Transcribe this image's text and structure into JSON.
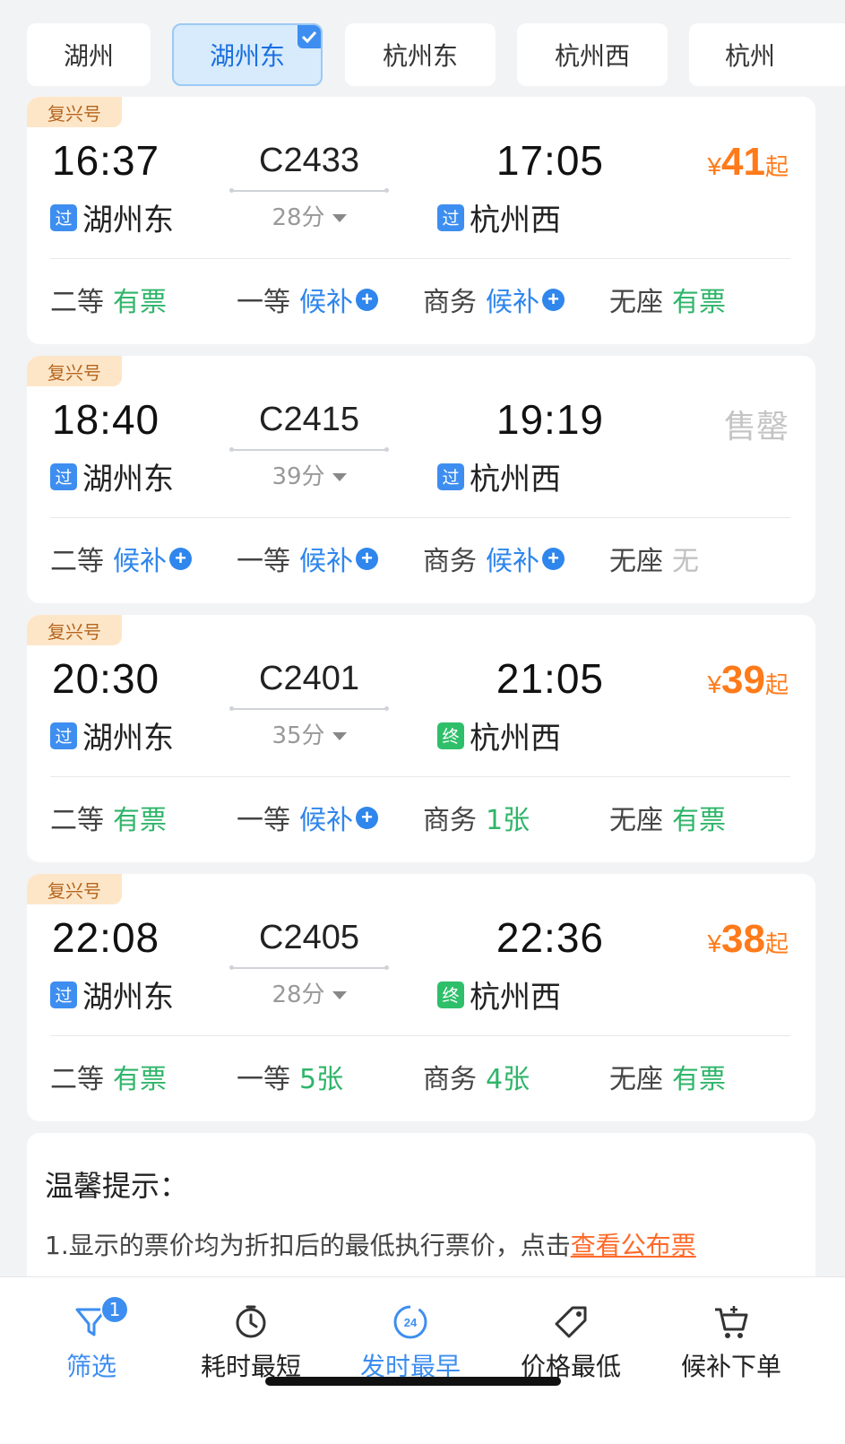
{
  "stations": [
    {
      "label": "湖州",
      "active": false
    },
    {
      "label": "湖州东",
      "active": true
    },
    {
      "label": "杭州东",
      "active": false
    },
    {
      "label": "杭州西",
      "active": false
    },
    {
      "label": "杭州",
      "active": false
    }
  ],
  "trains": [
    {
      "brand": "复兴号",
      "dep_time": "16:37",
      "arr_time": "17:05",
      "train_no": "C2433",
      "duration": "28分",
      "dep_tag": "过",
      "dep_station": "湖州东",
      "arr_tag": "过",
      "arr_station": "杭州西",
      "price_symbol": "¥",
      "price": "41",
      "price_suffix": "起",
      "status": "",
      "seats": [
        {
          "name": "二等",
          "value": "有票"
        },
        {
          "name": "一等",
          "value": "候补"
        },
        {
          "name": "商务",
          "value": "候补"
        },
        {
          "name": "无座",
          "value": "有票"
        }
      ]
    },
    {
      "brand": "复兴号",
      "dep_time": "18:40",
      "arr_time": "19:19",
      "train_no": "C2415",
      "duration": "39分",
      "dep_tag": "过",
      "dep_station": "湖州东",
      "arr_tag": "过",
      "arr_station": "杭州西",
      "price_symbol": "",
      "price": "",
      "price_suffix": "",
      "status": "售罄",
      "seats": [
        {
          "name": "二等",
          "value": "候补"
        },
        {
          "name": "一等",
          "value": "候补"
        },
        {
          "name": "商务",
          "value": "候补"
        },
        {
          "name": "无座",
          "value": "无"
        }
      ]
    },
    {
      "brand": "复兴号",
      "dep_time": "20:30",
      "arr_time": "21:05",
      "train_no": "C2401",
      "duration": "35分",
      "dep_tag": "过",
      "dep_station": "湖州东",
      "arr_tag": "终",
      "arr_station": "杭州西",
      "price_symbol": "¥",
      "price": "39",
      "price_suffix": "起",
      "status": "",
      "seats": [
        {
          "name": "二等",
          "value": "有票"
        },
        {
          "name": "一等",
          "value": "候补"
        },
        {
          "name": "商务",
          "value": "1张"
        },
        {
          "name": "无座",
          "value": "有票"
        }
      ]
    },
    {
      "brand": "复兴号",
      "dep_time": "22:08",
      "arr_time": "22:36",
      "train_no": "C2405",
      "duration": "28分",
      "dep_tag": "过",
      "dep_station": "湖州东",
      "arr_tag": "终",
      "arr_station": "杭州西",
      "price_symbol": "¥",
      "price": "38",
      "price_suffix": "起",
      "status": "",
      "seats": [
        {
          "name": "二等",
          "value": "有票"
        },
        {
          "name": "一等",
          "value": "5张"
        },
        {
          "name": "商务",
          "value": "4张"
        },
        {
          "name": "无座",
          "value": "有票"
        }
      ]
    }
  ],
  "tips": {
    "title": "温馨提示：",
    "line1": "1.显示的票价均为折扣后的最低执行票价，点击",
    "link": "查看公布票"
  },
  "tabbar": [
    {
      "label": "筛选",
      "icon": "filter-icon",
      "badge": "1"
    },
    {
      "label": "耗时最短",
      "icon": "clock-icon"
    },
    {
      "label": "发时最早",
      "icon": "24h-icon",
      "icon_text": "24"
    },
    {
      "label": "价格最低",
      "icon": "price-tag-icon"
    },
    {
      "label": "候补下单",
      "icon": "cart-plus-icon"
    }
  ],
  "colors": {
    "accent": "#3d8ef0",
    "price": "#ff7a1a",
    "available": "#2fb56a",
    "waitlist": "#2f86ec",
    "soldout": "#c4c4c4",
    "brand_bg": "#fde6c8"
  }
}
